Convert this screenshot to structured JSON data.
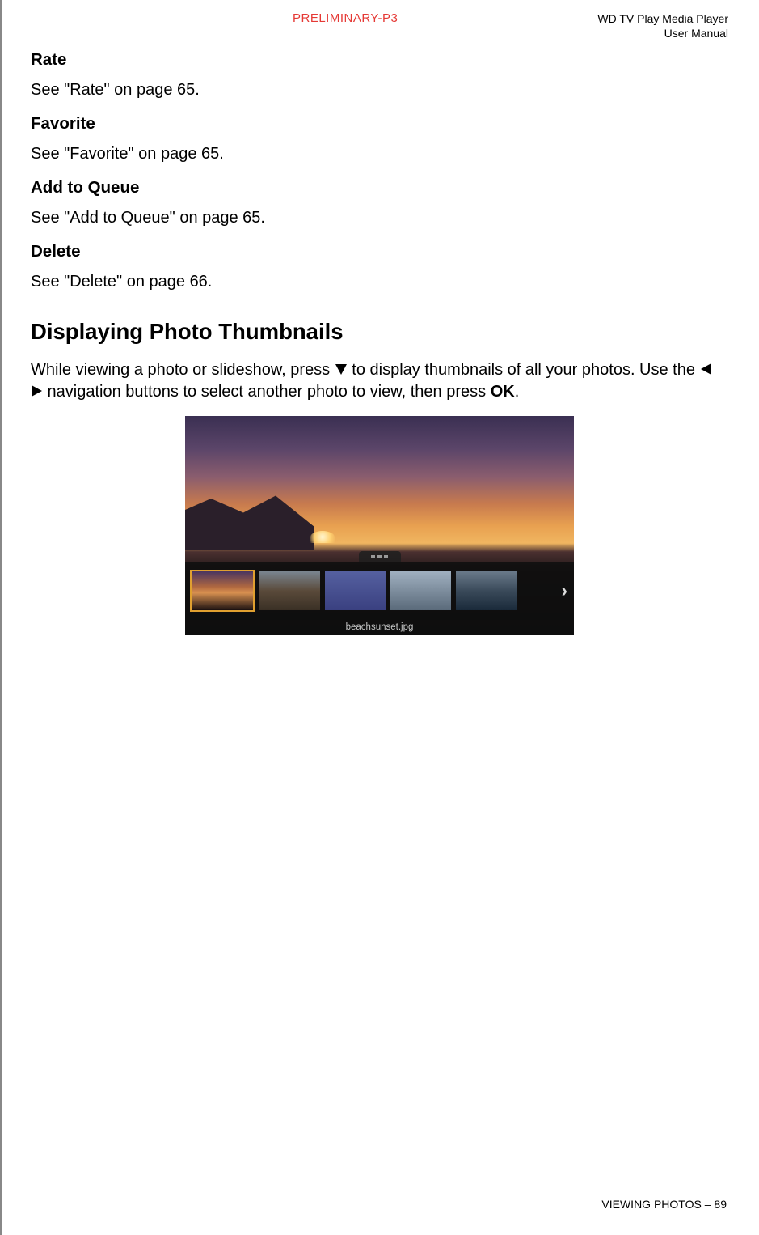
{
  "header": {
    "preliminary": "PRELIMINARY-P3",
    "device_line1": "WD TV Play Media Player",
    "device_line2": "User Manual"
  },
  "sections": {
    "rate": {
      "heading": "Rate",
      "body": "See \"Rate\" on page 65."
    },
    "favorite": {
      "heading": "Favorite",
      "body": "See \"Favorite\" on page 65."
    },
    "add_to_queue": {
      "heading": "Add to Queue",
      "body": "See \"Add to Queue\" on page 65."
    },
    "delete": {
      "heading": "Delete",
      "body": "See \"Delete\" on page 66."
    },
    "displaying": {
      "heading": "Displaying Photo Thumbnails",
      "para_part1": "While viewing a photo or slideshow, press ",
      "para_part2": " to display thumbnails of all your photos. Use the ",
      "para_part3": " navigation buttons to select another photo to view, then press ",
      "para_ok": "OK",
      "para_part4": "."
    }
  },
  "screenshot": {
    "caption": "beachsunset.jpg"
  },
  "footer": {
    "section": "VIEWING PHOTOS",
    "sep": " – ",
    "page": "89"
  }
}
